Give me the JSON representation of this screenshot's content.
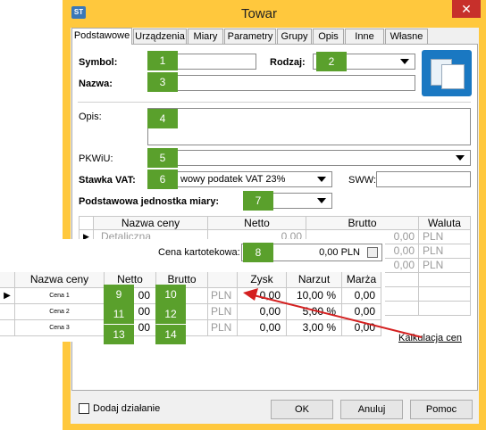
{
  "window": {
    "title": "Towar",
    "icon_label": "ST",
    "close_glyph": "✕"
  },
  "tabs": [
    "Podstawowe",
    "Urządzenia",
    "Miary",
    "Parametry",
    "Grupy",
    "Opis",
    "Inne",
    "Własne"
  ],
  "form": {
    "symbol_label": "Symbol:",
    "rodzaj_label": "Rodzaj:",
    "nazwa_label": "Nazwa:",
    "opis_label": "Opis:",
    "pkwiu_label": "PKWiU:",
    "stawka_vat_label": "Stawka VAT:",
    "stawka_vat_value": "wowy podatek VAT 23%",
    "sww_label": "SWW:",
    "jednostka_label": "Podstawowa jednostka miary:"
  },
  "price_grid": {
    "headers": [
      "Nazwa ceny",
      "Netto",
      "Brutto",
      "Waluta"
    ],
    "row_marker": "▶",
    "first_row_name": "Detaliczna",
    "netto_first": "0,00",
    "brutto_values": [
      "0,00",
      "0,00",
      "0,00"
    ],
    "waluta_values": [
      "PLN",
      "PLN",
      "PLN"
    ]
  },
  "overlay": {
    "cena_kartotekowa_label": "Cena kartotekowa:",
    "cena_kartotekowa_value": "0,00 PLN",
    "headers": [
      "Nazwa ceny",
      "Netto",
      "Brutto",
      "",
      "Zysk",
      "Narzut",
      "Marża"
    ],
    "row_marker": "▶",
    "rows": [
      {
        "name": "Cena 1",
        "netto": "00",
        "currency": "PLN",
        "zysk": "0,00",
        "narzut": "10,00 %",
        "marza": "0,00"
      },
      {
        "name": "Cena 2",
        "netto": "00",
        "currency": "PLN",
        "zysk": "0,00",
        "narzut": "5,00 %",
        "marza": "0,00"
      },
      {
        "name": "Cena 3",
        "netto": "00",
        "currency": "PLN",
        "zysk": "0,00",
        "narzut": "3,00 %",
        "marza": "0,00"
      }
    ],
    "kalkulacja_link": "Kalkulacja cen"
  },
  "badges": [
    "1",
    "2",
    "3",
    "4",
    "5",
    "6",
    "7",
    "8",
    "9",
    "10",
    "11",
    "12",
    "13",
    "14"
  ],
  "footer": {
    "dodaj_dzialanie_label": "Dodaj działanie",
    "ok_label": "OK",
    "anuluj_label": "Anuluj",
    "pomoc_label": "Pomoc"
  },
  "colors": {
    "window_border": "#ffc83d",
    "badge": "#5aa02c",
    "close": "#c7302b",
    "arrow": "#d42020"
  }
}
